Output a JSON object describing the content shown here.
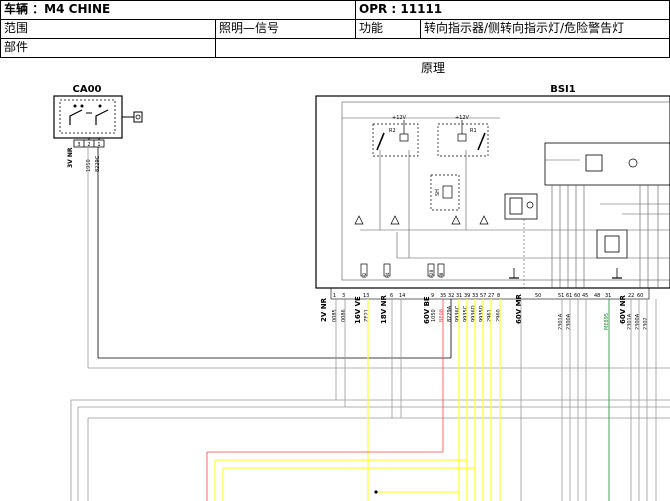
{
  "header": {
    "vehicle": "车辆 ：M4 CHINE",
    "opr": "OPR : 11111",
    "scope_label": "范围",
    "scope_value": "照明—信号",
    "function_label": "功能",
    "function_value": "转向指示器/侧转向指示灯/危险警告灯",
    "parts_label": "部件",
    "parts_value": ""
  },
  "diagram": {
    "section_title": "原理",
    "components": {
      "ca00": "CA00",
      "bsi1": "BSI1"
    },
    "relays": {
      "r2": "R2",
      "r1": "R1",
      "r2_supply": "+12V",
      "r1_supply": "+12V"
    },
    "fuses": {
      "f2": "F2",
      "f4": "F4",
      "f28": "F28",
      "f8": "F8",
      "sh": "SH"
    },
    "ca00_connector": {
      "name": "3V NR",
      "pins": [
        "3",
        "2",
        "1"
      ],
      "wires": [
        "1950",
        "8229C"
      ]
    },
    "bsi_connectors": [
      {
        "name": "2V NR",
        "pins": [
          "1",
          "3"
        ],
        "wires": [
          "0085",
          "0086"
        ]
      },
      {
        "name": "16V VE",
        "pins": [
          "13"
        ],
        "wires": [
          "ZE21"
        ]
      },
      {
        "name": "18V NR",
        "pins": [
          "6",
          "14"
        ],
        "wires": []
      },
      {
        "name": "60V BE",
        "pins": [
          "9",
          "35",
          "32",
          "31",
          "39",
          "33",
          "57",
          "27",
          "8"
        ],
        "wires": [
          "1050",
          "BE08",
          "8229A",
          "9936C",
          "9935C",
          "9936D",
          "9935D",
          "2961",
          "2960"
        ]
      },
      {
        "name": "60V MR",
        "pins": [
          "50",
          "51",
          "61",
          "60",
          "45",
          "48",
          "31",
          "22",
          "60"
        ],
        "wires": [
          "2301A",
          "2300A",
          "ME895",
          "2301A",
          "2300A",
          "2302"
        ]
      },
      {
        "name": "60V NR",
        "pins": [],
        "wires": []
      }
    ],
    "wire_colors": {
      "ground": "#000000",
      "signal": "#ffff33",
      "fault": "#ff4444",
      "gray": "#999999",
      "network": "#228833"
    }
  }
}
